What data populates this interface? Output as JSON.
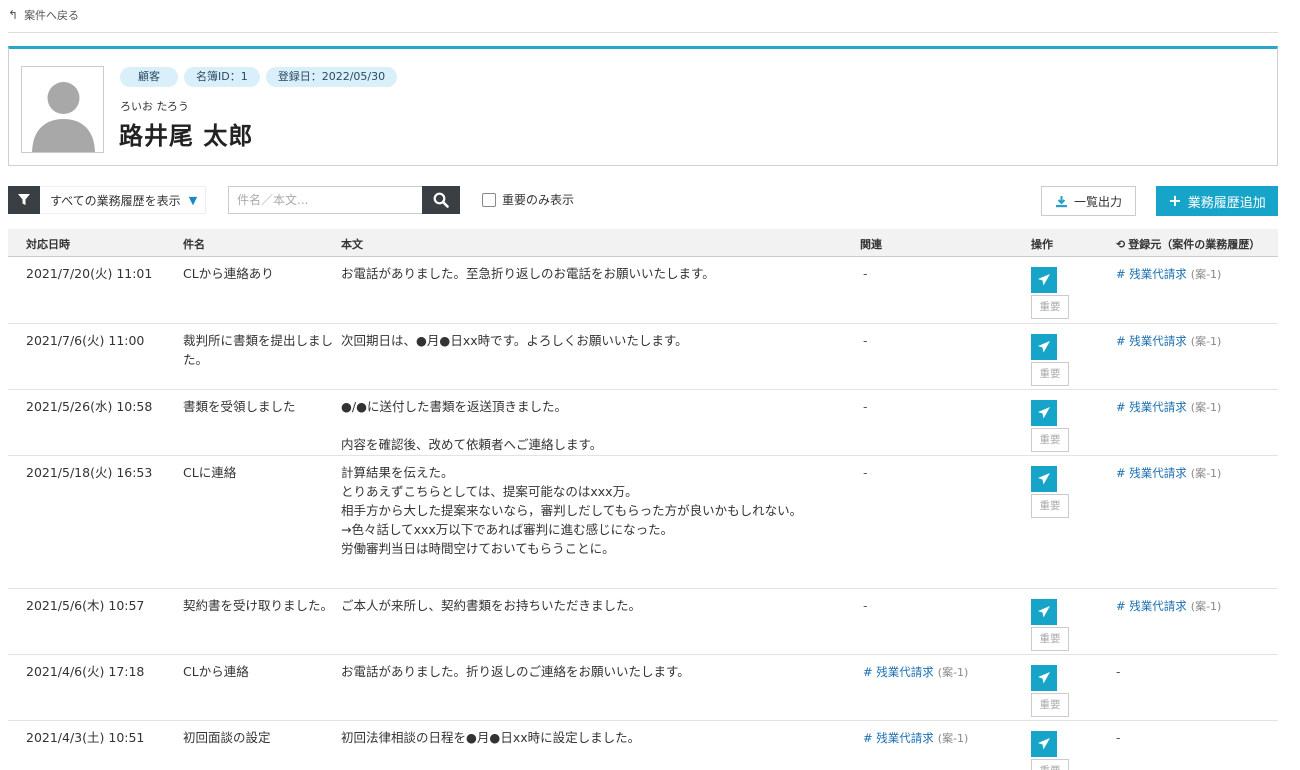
{
  "nav": {
    "back_label": "案件へ戻る"
  },
  "client": {
    "type_badge": "顧客",
    "roster_id": "名簿ID：1",
    "registered": "登録日：2022/05/30",
    "kana": "ろいお たろう",
    "name": "路井尾 太郎"
  },
  "toolbar": {
    "filter_label": "すべての業務履歴を表示",
    "search_placeholder": "件名／本文...",
    "important_only_label": "重要のみ表示",
    "export_label": "一覧出力",
    "add_label": "業務履歴追加"
  },
  "table": {
    "headers": {
      "date": "対応日時",
      "subject": "件名",
      "body": "本文",
      "related": "関連",
      "ops": "操作",
      "source": "登録元（案件の業務履歴）"
    },
    "important_label": "重要",
    "rows": [
      {
        "date": "2021/7/20(火) 11:01",
        "subject": "CLから連絡あり",
        "body": [
          "お電話がありました。至急折り返しのお電話をお願いいたします。"
        ],
        "related": "-",
        "source_tag": "# 残業代請求",
        "source_sub": "(案-1)"
      },
      {
        "date": "2021/7/6(火) 11:00",
        "subject": "裁判所に書類を提出しました。",
        "body": [
          "次回期日は、●月●日xx時です。よろしくお願いいたします。"
        ],
        "related": "-",
        "source_tag": "# 残業代請求",
        "source_sub": "(案-1)"
      },
      {
        "date": "2021/5/26(水) 10:58",
        "subject": "書類を受領しました",
        "body": [
          "●/●に送付した書類を返送頂きました。",
          "",
          "内容を確認後、改めて依頼者へご連絡します。"
        ],
        "related": "-",
        "source_tag": "# 残業代請求",
        "source_sub": "(案-1)"
      },
      {
        "date": "2021/5/18(火) 16:53",
        "subject": "CLに連絡",
        "body": [
          "計算結果を伝えた。",
          "とりあえずこちらとしては、提案可能なのはxxx万。",
          "相手方から大した提案来ないなら，審判しだしてもらった方が良いかもしれない。",
          "→色々話してxxx万以下であれば審判に進む感じになった。",
          "労働審判当日は時間空けておいてもらうことに。"
        ],
        "related": "-",
        "source_tag": "# 残業代請求",
        "source_sub": "(案-1)"
      },
      {
        "date": "2021/5/6(木) 10:57",
        "subject": "契約書を受け取りました。",
        "body": [
          "ご本人が来所し、契約書類をお持ちいただきました。"
        ],
        "related": "-",
        "source_tag": "# 残業代請求",
        "source_sub": "(案-1)"
      },
      {
        "date": "2021/4/6(火) 17:18",
        "subject": "CLから連絡",
        "body": [
          "お電話がありました。折り返しのご連絡をお願いいたします。"
        ],
        "related_tag": "# 残業代請求",
        "related_sub": "(案-1)",
        "source": "-"
      },
      {
        "date": "2021/4/3(土) 10:51",
        "subject": "初回面談の設定",
        "body": [
          "初回法律相談の日程を●月●日xx時に設定しました。"
        ],
        "related_tag": "# 残業代請求",
        "related_sub": "(案-1)",
        "source": "-"
      }
    ]
  }
}
